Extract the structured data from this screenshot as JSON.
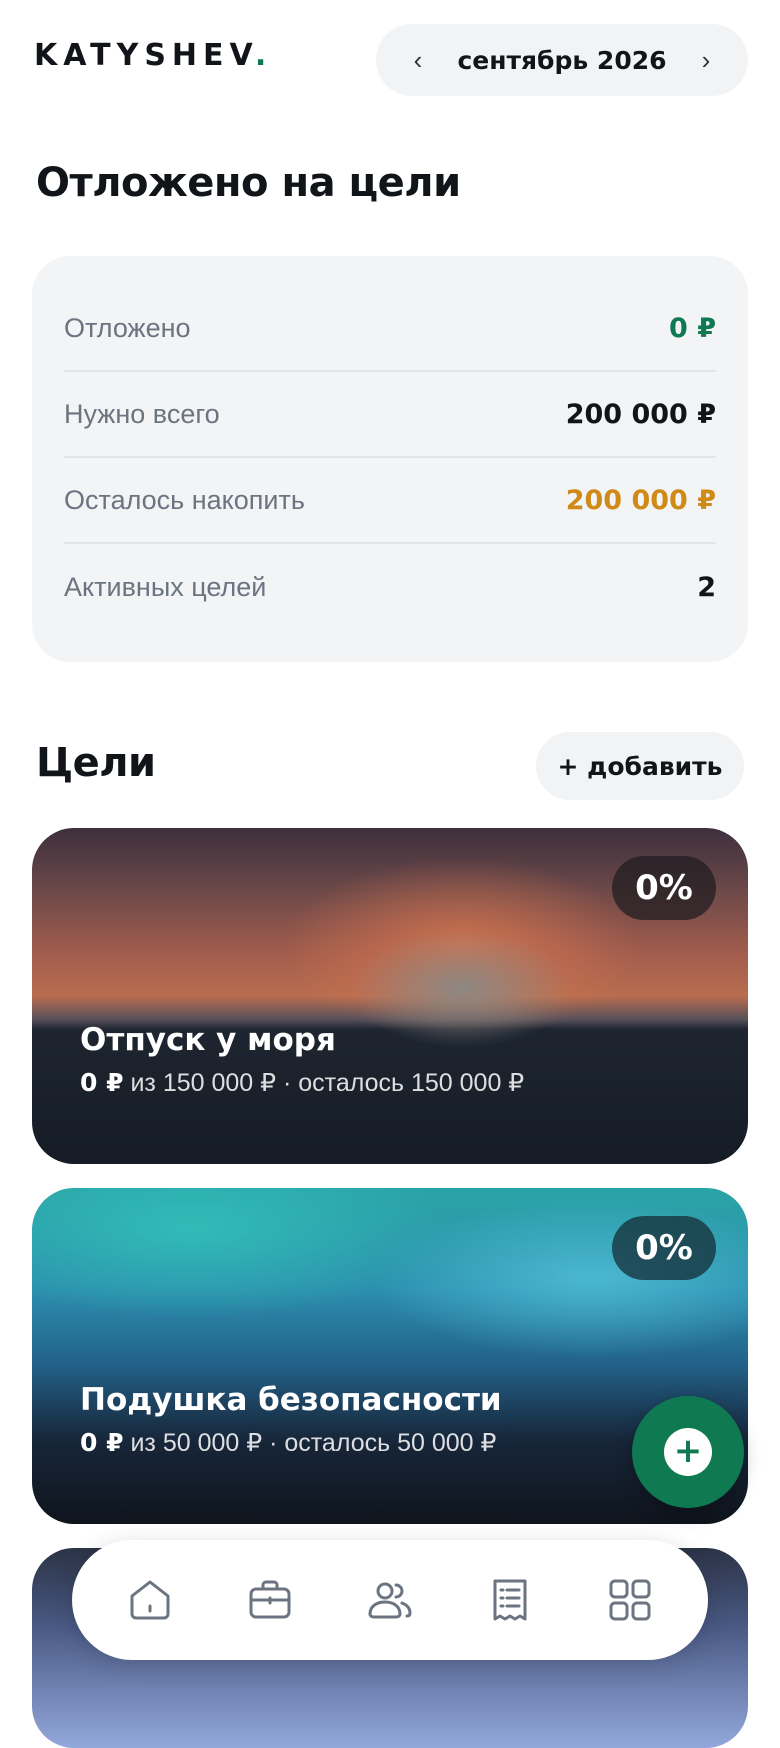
{
  "header": {
    "logo_text": "KATYSHEV",
    "logo_dot": ".",
    "month_label": "сентябрь 2026",
    "prev_icon": "chevron-left-icon",
    "next_icon": "chevron-right-icon"
  },
  "summary": {
    "title": "Отложено на цели",
    "rows": [
      {
        "label": "Отложено",
        "value": "0 ₽",
        "color": "#0f7a52"
      },
      {
        "label": "Нужно всего",
        "value": "200 000 ₽",
        "color": "#111418"
      },
      {
        "label": "Осталось накопить",
        "value": "200 000 ₽",
        "color": "#d08a17"
      },
      {
        "label": "Активных целей",
        "value": "2",
        "color": "#111418"
      }
    ]
  },
  "goals": {
    "title": "Цели",
    "add_label": "+ добавить",
    "items": [
      {
        "percent": "0%",
        "name": "Отпуск у моря",
        "saved": "0 ₽",
        "rest": "из 150 000 ₽ · осталось 150 000 ₽",
        "progress": 0
      },
      {
        "percent": "0%",
        "name": "Подушка безопасности",
        "saved": "0 ₽",
        "rest": "из 50 000 ₽ · осталось 50 000 ₽",
        "progress": 0
      }
    ]
  },
  "fab": {
    "icon": "plus-icon"
  },
  "nav": {
    "items": [
      {
        "icon": "home-icon"
      },
      {
        "icon": "briefcase-icon"
      },
      {
        "icon": "users-icon"
      },
      {
        "icon": "receipt-icon"
      },
      {
        "icon": "grid-icon"
      }
    ]
  },
  "colors": {
    "accent": "#0f7a52",
    "warning": "#d08a17"
  }
}
